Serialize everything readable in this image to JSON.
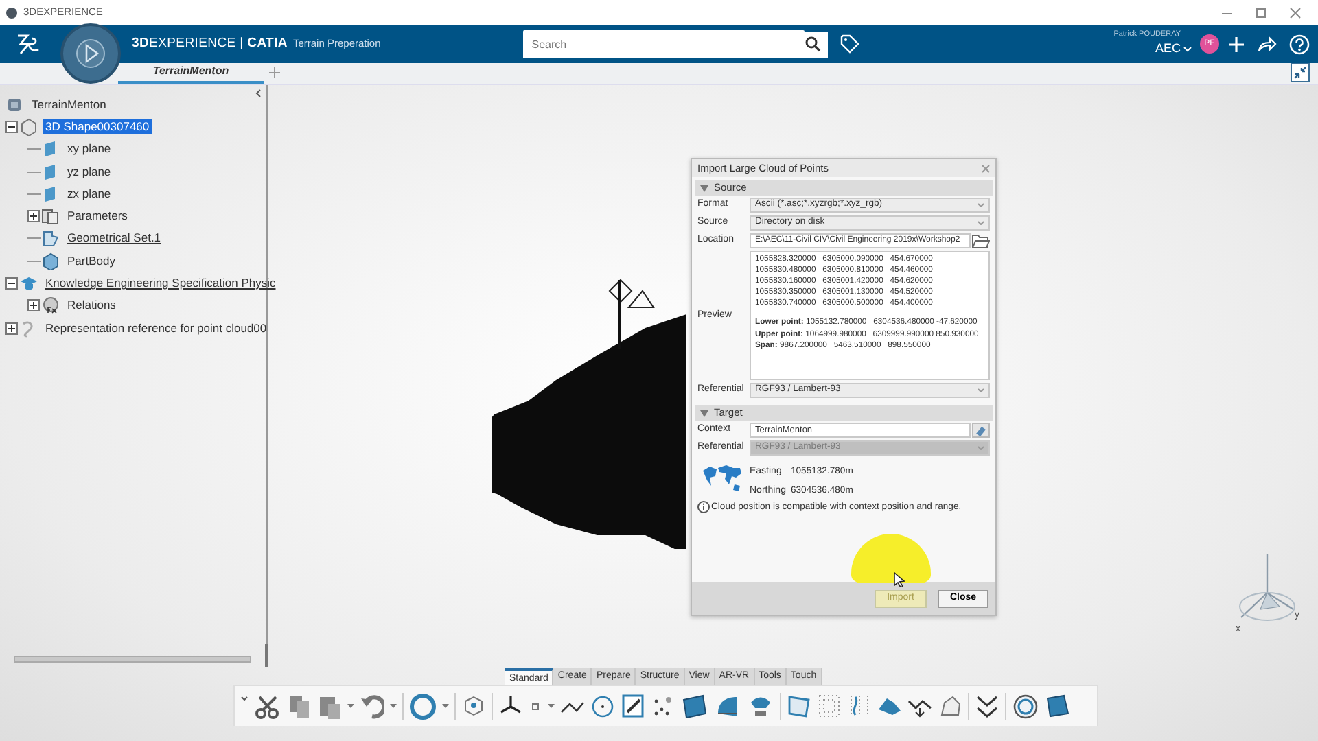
{
  "title_bar": {
    "title": "3DEXPERIENCE"
  },
  "header": {
    "brand": "**3D**EXPERIENCE | **CATIA**",
    "app": "Terrain Preperation",
    "search": {
      "placeholder": "Search"
    },
    "user": "Patrick POUDERAY",
    "role": "AEC",
    "avatar": "PF"
  },
  "tabs": [
    {
      "label": "TerrainMenton",
      "selected": true
    }
  ],
  "tree": {
    "label": "TerrainMenton",
    "kind": "product",
    "selected": false,
    "underlined": false,
    "children": [
      {
        "label": "3D Shape00307460",
        "kind": "part",
        "selected": true,
        "underlined": false,
        "expanded": true,
        "children": [
          {
            "label": "xy plane",
            "kind": "plane",
            "selected": false,
            "underlined": false
          },
          {
            "label": "yz plane",
            "kind": "plane",
            "selected": false,
            "underlined": false
          },
          {
            "label": "zx plane",
            "kind": "plane",
            "selected": false,
            "underlined": false
          },
          {
            "label": "Parameters",
            "kind": "parameters",
            "selected": false,
            "underlined": false,
            "expanded": false
          },
          {
            "label": "Geometrical Set.1",
            "kind": "geoset",
            "selected": false,
            "underlined": true
          },
          {
            "label": "PartBody",
            "kind": "body",
            "selected": false,
            "underlined": false
          }
        ]
      },
      {
        "label": "Knowledge Engineering Specification Physic",
        "kind": "knowledge",
        "selected": false,
        "underlined": true,
        "expanded": true,
        "children": [
          {
            "label": "Relations",
            "kind": "relations",
            "selected": false,
            "underlined": false,
            "expanded": false
          }
        ]
      },
      {
        "label": "Representation reference for point cloud00",
        "kind": "reference",
        "selected": false,
        "underlined": false,
        "expanded": false
      }
    ]
  },
  "dialog": {
    "title": "Import Large Cloud of Points",
    "source": {
      "heading": "Source",
      "expanded": true,
      "format": {
        "label": "Format",
        "value": "Ascii (*.asc;*.xyzrgb;*.xyz_rgb)"
      },
      "source": {
        "label": "Source",
        "value": "Directory on disk"
      },
      "location": {
        "label": "Location",
        "value": "E:\\AEC\\11-Civil CIV\\Civil Engineering 2019x\\Workshop2"
      },
      "preview": {
        "label": "Preview",
        "lines": [
          "1055828.320000   6305000.090000   454.670000",
          "1055830.480000   6305000.810000   454.460000",
          "1055830.160000   6305001.420000   454.620000",
          "1055830.350000   6305001.130000   454.520000",
          "1055830.740000   6305000.500000   454.400000"
        ],
        "stats": [
          "**Lower point:** 1055132.780000   6304536.480000 -47.620000",
          "**Upper point:** 1064999.980000   6309999.990000 850.930000",
          "**Span:** 9867.200000   5463.510000   898.550000"
        ]
      },
      "referential": {
        "label": "Referential",
        "value": "RGF93 / Lambert-93"
      }
    },
    "target": {
      "heading": "Target",
      "expanded": true,
      "context": {
        "label": "Context",
        "value": "TerrainMenton"
      },
      "referential": {
        "label": "Referential",
        "value": "RGF93 / Lambert-93",
        "disabled": true
      },
      "easting": {
        "label": "Easting",
        "value": "1055132.780m"
      },
      "northing": {
        "label": "Northing",
        "value": "6304536.480m"
      },
      "message": "Cloud position is compatible with context position and range."
    },
    "buttons": [
      {
        "label": "Import",
        "disabled": true
      },
      {
        "label": "Close",
        "disabled": false
      }
    ]
  },
  "compass": {
    "axes": [
      "x",
      "y"
    ]
  },
  "toolbar": {
    "tabs": [
      {
        "label": "Standard",
        "selected": true
      },
      {
        "label": "Create",
        "selected": false
      },
      {
        "label": "Prepare",
        "selected": false
      },
      {
        "label": "Structure",
        "selected": false
      },
      {
        "label": "View",
        "selected": false
      },
      {
        "label": "AR-VR",
        "selected": false
      },
      {
        "label": "Tools",
        "selected": false
      },
      {
        "label": "Touch",
        "selected": false
      }
    ]
  }
}
